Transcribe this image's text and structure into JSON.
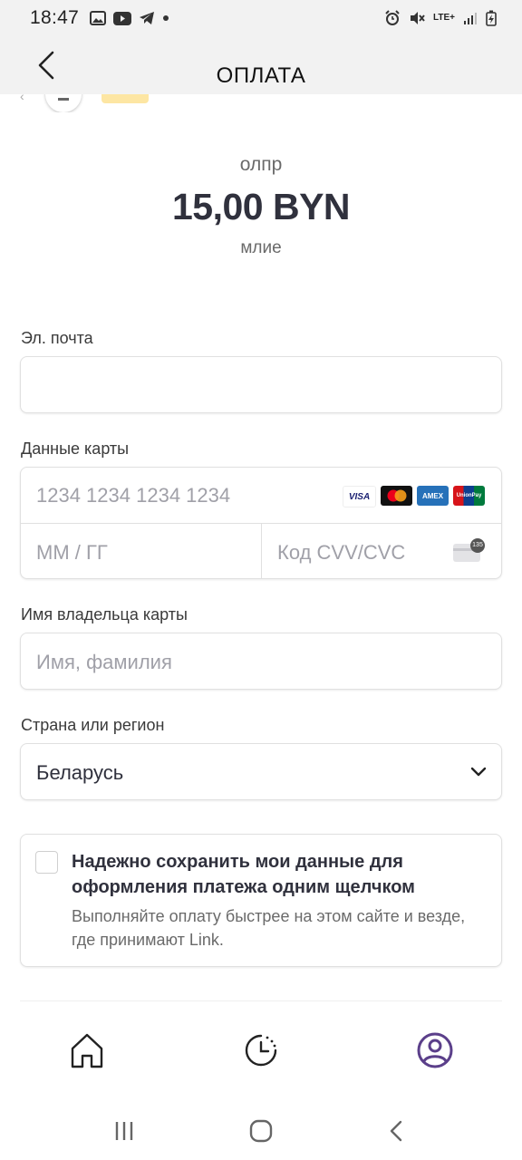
{
  "status_bar": {
    "time": "18:47",
    "network": "LTE+"
  },
  "header": {
    "title": "ОПЛАТА"
  },
  "summary": {
    "name": "олпр",
    "amount": "15,00 BYN",
    "description": "млие"
  },
  "email": {
    "label": "Эл. почта",
    "value": "",
    "placeholder": ""
  },
  "card": {
    "label": "Данные карты",
    "number_placeholder": "1234 1234 1234 1234",
    "expiry_placeholder": "ММ / ГГ",
    "cvc_placeholder": "Код CVV/CVC",
    "cvc_badge": "135",
    "brands": [
      "VISA",
      "AMEX",
      "UnionPay"
    ]
  },
  "cardholder": {
    "label": "Имя владельца карты",
    "placeholder": "Имя, фамилия"
  },
  "country": {
    "label": "Страна или регион",
    "selected": "Беларусь"
  },
  "save_info": {
    "title": "Надежно сохранить мои данные для оформления платежа одним щелчком",
    "subtitle": "Выполняйте оплату быстрее на этом сайте и везде, где принимают Link.",
    "checked": false
  },
  "colors": {
    "accent": "#5b3f8a",
    "visa": "#1a1f71",
    "amex": "#2671b9",
    "test_badge": "#fde6a3"
  }
}
